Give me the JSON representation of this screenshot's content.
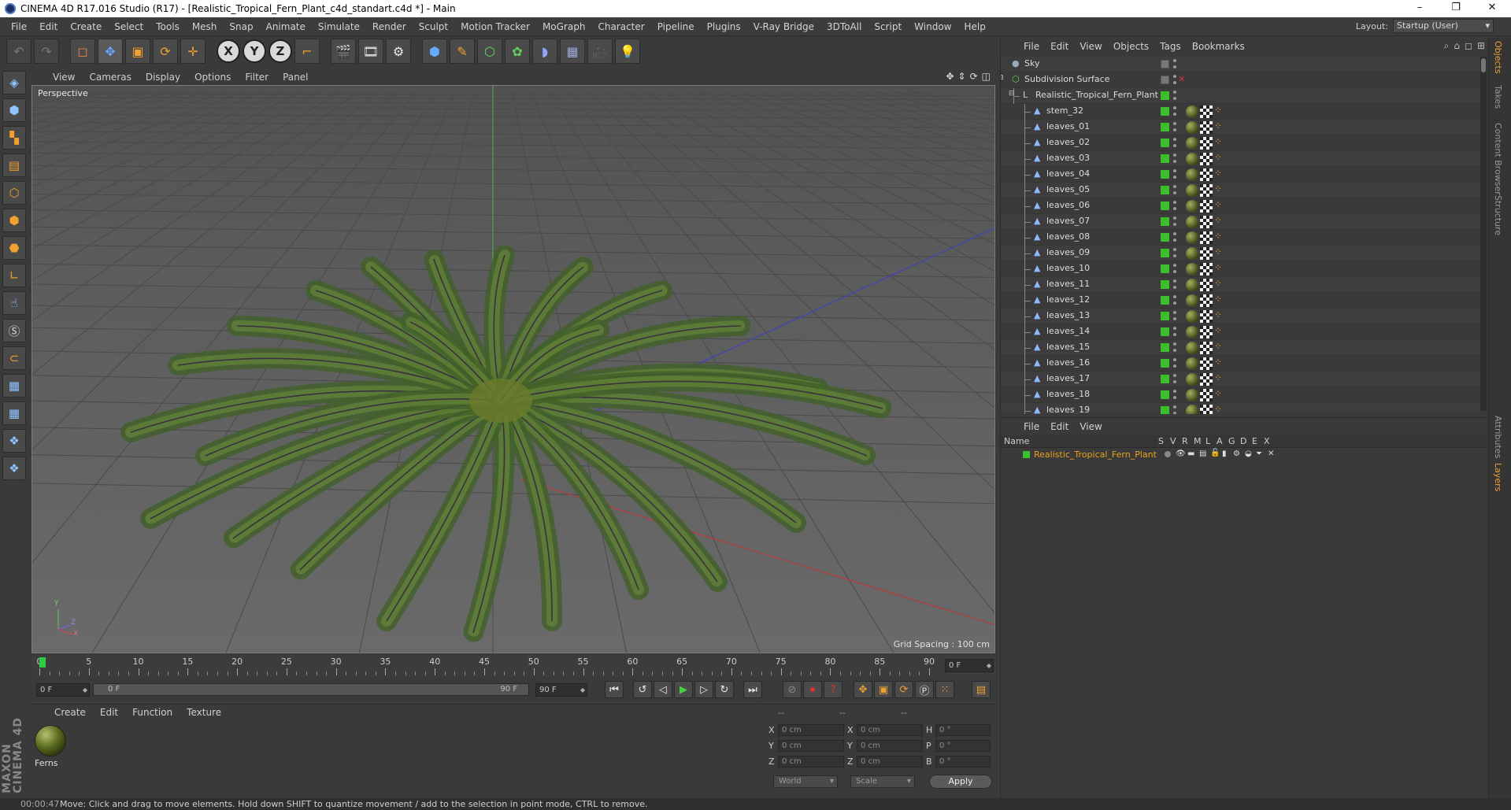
{
  "window": {
    "title": "CINEMA 4D R17.016 Studio (R17) - [Realistic_Tropical_Fern_Plant_c4d_standart.c4d *] - Main",
    "controls": [
      "–",
      "❐",
      "✕"
    ]
  },
  "menubar": {
    "items": [
      "File",
      "Edit",
      "Create",
      "Select",
      "Tools",
      "Mesh",
      "Snap",
      "Animate",
      "Simulate",
      "Render",
      "Sculpt",
      "Motion Tracker",
      "MoGraph",
      "Character",
      "Pipeline",
      "Plugins",
      "V-Ray Bridge",
      "3DToAll",
      "Script",
      "Window",
      "Help"
    ],
    "layout_label": "Layout:",
    "layout_value": "Startup (User)"
  },
  "viewport": {
    "menu": [
      "View",
      "Cameras",
      "Display",
      "Options",
      "Filter",
      "Panel"
    ],
    "label": "Perspective",
    "grid_spacing": "Grid Spacing : 100 cm",
    "axis_labels": {
      "y": "Y",
      "z": "Z",
      "x": "X"
    }
  },
  "timeline": {
    "ticks": [
      "0",
      "5",
      "10",
      "15",
      "20",
      "25",
      "30",
      "35",
      "40",
      "45",
      "50",
      "55",
      "60",
      "65",
      "70",
      "75",
      "80",
      "85",
      "90"
    ],
    "current_frame_right": "0 F"
  },
  "transport": {
    "start_field": "0 F",
    "slider_left": "0 F",
    "slider_right": "90 F",
    "end_field": "90 F"
  },
  "material_manager": {
    "menu": [
      "Create",
      "Edit",
      "Function",
      "Texture"
    ],
    "materials": [
      {
        "name": "Ferns"
      }
    ]
  },
  "coordinates": {
    "headers": [
      "--",
      "--",
      "--"
    ],
    "rows": [
      {
        "l1": "X",
        "v1": "0 cm",
        "l2": "X",
        "v2": "0 cm",
        "l3": "H",
        "v3": "0 °"
      },
      {
        "l1": "Y",
        "v1": "0 cm",
        "l2": "Y",
        "v2": "0 cm",
        "l3": "P",
        "v3": "0 °"
      },
      {
        "l1": "Z",
        "v1": "0 cm",
        "l2": "Z",
        "v2": "0 cm",
        "l3": "B",
        "v3": "0 °"
      }
    ],
    "mode1": "World",
    "mode2": "Scale",
    "apply": "Apply"
  },
  "status": {
    "time": "00:00:47",
    "message": "Move: Click and drag to move elements. Hold down SHIFT to quantize movement / add to the selection in point mode, CTRL to remove."
  },
  "object_manager": {
    "menu": [
      "File",
      "Edit",
      "View",
      "Objects",
      "Tags",
      "Bookmarks"
    ],
    "objects": [
      {
        "name": "Sky",
        "level": 0,
        "type": "sky"
      },
      {
        "name": "Subdivision Surface",
        "level": 0,
        "type": "subd"
      },
      {
        "name": "Realistic_Tropical_Fern_Plant",
        "level": 1,
        "type": "null"
      },
      {
        "name": "stem_32",
        "level": 2,
        "type": "poly"
      },
      {
        "name": "leaves_01",
        "level": 2,
        "type": "poly"
      },
      {
        "name": "leaves_02",
        "level": 2,
        "type": "poly"
      },
      {
        "name": "leaves_03",
        "level": 2,
        "type": "poly"
      },
      {
        "name": "leaves_04",
        "level": 2,
        "type": "poly"
      },
      {
        "name": "leaves_05",
        "level": 2,
        "type": "poly"
      },
      {
        "name": "leaves_06",
        "level": 2,
        "type": "poly"
      },
      {
        "name": "leaves_07",
        "level": 2,
        "type": "poly"
      },
      {
        "name": "leaves_08",
        "level": 2,
        "type": "poly"
      },
      {
        "name": "leaves_09",
        "level": 2,
        "type": "poly"
      },
      {
        "name": "leaves_10",
        "level": 2,
        "type": "poly"
      },
      {
        "name": "leaves_11",
        "level": 2,
        "type": "poly"
      },
      {
        "name": "leaves_12",
        "level": 2,
        "type": "poly"
      },
      {
        "name": "leaves_13",
        "level": 2,
        "type": "poly"
      },
      {
        "name": "leaves_14",
        "level": 2,
        "type": "poly"
      },
      {
        "name": "leaves_15",
        "level": 2,
        "type": "poly"
      },
      {
        "name": "leaves_16",
        "level": 2,
        "type": "poly"
      },
      {
        "name": "leaves_17",
        "level": 2,
        "type": "poly"
      },
      {
        "name": "leaves_18",
        "level": 2,
        "type": "poly"
      },
      {
        "name": "leaves_19",
        "level": 2,
        "type": "poly"
      }
    ]
  },
  "layer_manager": {
    "menu": [
      "File",
      "Edit",
      "View"
    ],
    "columns": [
      "Name",
      "S",
      "V",
      "R",
      "M",
      "L",
      "A",
      "G",
      "D",
      "E",
      "X"
    ],
    "layers": [
      {
        "name": "Realistic_Tropical_Fern_Plant",
        "color": "#3cbf2c"
      }
    ]
  },
  "side_tabs": [
    "Objects",
    "Takes",
    "Content Browser",
    "Structure",
    "Attributes",
    "Layers"
  ],
  "colors": {
    "accent": "#f0a030",
    "layer_name": "#e8a21e",
    "green": "#3cbf2c",
    "viewport_bg": "#5d5d5d"
  }
}
